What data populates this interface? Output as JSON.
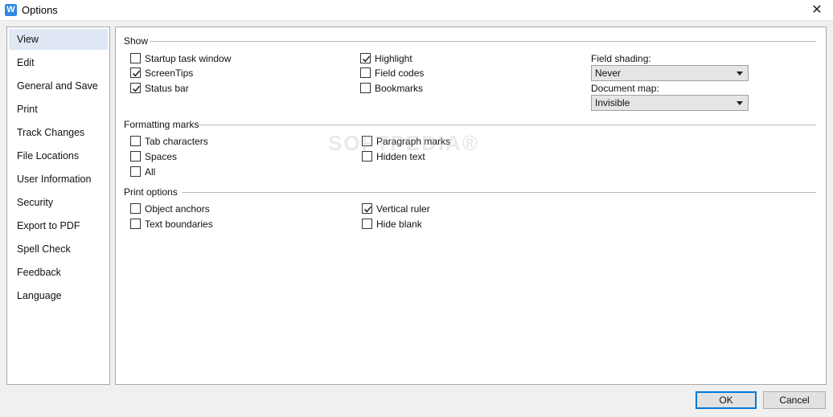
{
  "window": {
    "title": "Options",
    "app_icon_glyph": "W",
    "close_glyph": "✕"
  },
  "sidebar": {
    "items": [
      {
        "label": "View",
        "active": true
      },
      {
        "label": "Edit"
      },
      {
        "label": "General and Save"
      },
      {
        "label": "Print"
      },
      {
        "label": "Track Changes"
      },
      {
        "label": "File Locations"
      },
      {
        "label": "User Information"
      },
      {
        "label": "Security"
      },
      {
        "label": "Export to PDF"
      },
      {
        "label": "Spell Check"
      },
      {
        "label": "Feedback"
      },
      {
        "label": "Language"
      }
    ]
  },
  "show": {
    "title": "Show",
    "startup_task_window": {
      "label": "Startup task window",
      "checked": false
    },
    "screentips": {
      "label": "ScreenTips",
      "checked": true
    },
    "status_bar": {
      "label": "Status bar",
      "checked": true
    },
    "highlight": {
      "label": "Highlight",
      "checked": true
    },
    "field_codes": {
      "label": "Field codes",
      "checked": false
    },
    "bookmarks": {
      "label": "Bookmarks",
      "checked": false
    },
    "field_shading": {
      "label": "Field shading:",
      "value": "Never"
    },
    "document_map": {
      "label": "Document map:",
      "value": "Invisible"
    }
  },
  "formatting_marks": {
    "title": "Formatting marks",
    "tab_characters": {
      "label": "Tab characters",
      "checked": false
    },
    "spaces": {
      "label": "Spaces",
      "checked": false
    },
    "all": {
      "label": "All",
      "checked": false
    },
    "paragraph_marks": {
      "label": "Paragraph marks",
      "checked": false
    },
    "hidden_text": {
      "label": "Hidden text",
      "checked": false
    }
  },
  "print_options": {
    "title": "Print options",
    "object_anchors": {
      "label": "Object anchors",
      "checked": false
    },
    "text_boundaries": {
      "label": "Text boundaries",
      "checked": false
    },
    "vertical_ruler": {
      "label": "Vertical ruler",
      "checked": true
    },
    "hide_blank": {
      "label": "Hide blank",
      "checked": false
    }
  },
  "footer": {
    "ok_label": "OK",
    "cancel_label": "Cancel"
  },
  "watermark": "SOFTPEDIA®",
  "colors": {
    "accent": "#0078d7",
    "app_icon": "#2f8ae0",
    "nav_active": "#dfe8f4"
  }
}
